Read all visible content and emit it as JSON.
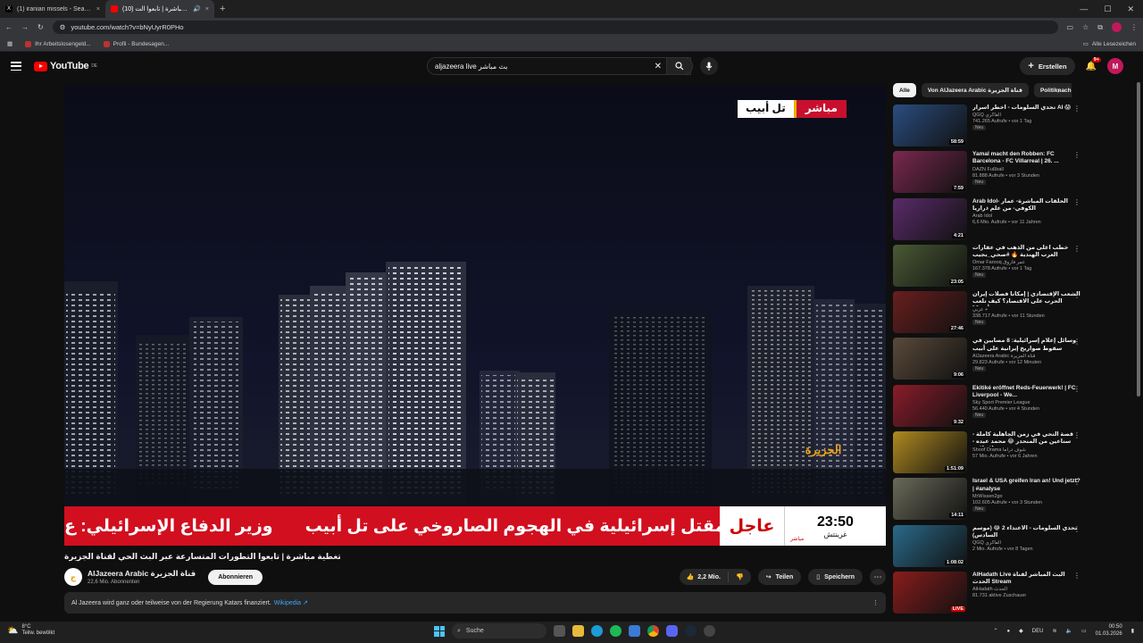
{
  "browser": {
    "tabs": [
      {
        "label": "(1) iranian missels - Search / X",
        "icon_color": "#000000",
        "close": "×"
      },
      {
        "label": "(10) تغطية مباشرة | تابعوا الت...",
        "icon_color": "#ff0000",
        "close": "×",
        "audio": "🔊"
      }
    ],
    "new_tab": "+",
    "url": "youtube.com/watch?v=bNyUyrR0PHo",
    "bookmarks": [
      "Ihr Arbeitslosengeld...",
      "Profil - Bundesagen..."
    ],
    "all_bookmarks": "Alle Lesezeichen"
  },
  "youtube": {
    "logo_text": "YouTube",
    "logo_region": "DE",
    "search_value": "aljazeera live بث مباشر",
    "create_label": "Erstellen",
    "notification_count": "9+",
    "avatar_letter": "M"
  },
  "player": {
    "live_badge": "مباشر",
    "location": "تل أبيب",
    "logo_glyph": "الجزيرة",
    "ticker_text": "ية: مقتل إسرائيلية في الهجوم الصاروخي على تل أبيب",
    "ticker_text2": "وزير الدفاع الإسرائيلي: ع",
    "urgent_label": "عاجل",
    "clock_time": "23:50",
    "clock_zone": "غرينتش",
    "clock_live": "مباشر"
  },
  "video": {
    "title": "تغطية مباشرة | تابعوا التطورات المتسارعة عبر البث الحي لقناة الجزيرة",
    "channel_name": "AlJazeera Arabic قناة الجزيرة",
    "channel_avatar": "ج",
    "subscribers": "22,6 Mio. Abonnenten",
    "subscribe_label": "Abonnieren",
    "likes": "2,2 Mio.",
    "share_label": "Teilen",
    "save_label": "Speichern",
    "notice_text": "Al Jazeera wird ganz oder teilweise von der Regierung Katars finanziert.",
    "notice_link": "Wikipedia ↗"
  },
  "chips": [
    "Alle",
    "Von AlJazeera Arabic قناة الجزيرة",
    "Politiknachrichten"
  ],
  "recommendations": [
    {
      "title": "تحدي السلومات - أخطر أسرار AI 😱",
      "channel": "QGQ الفاكري",
      "meta": "741.265 Aufrufe • vor 1 Tag",
      "duration": "58:59",
      "new": "Neu",
      "color": "#2a4d80"
    },
    {
      "title": "Yamal macht den Robben: FC Barcelona - FC Villarreal | 26. ...",
      "channel": "DAZN Fußball",
      "meta": "81.888 Aufrufe • vor 3 Stunden",
      "duration": "7:59",
      "new": "Neu",
      "color": "#7a2850"
    },
    {
      "title": "Arab Idol- الحلقات المباشرة- عمار الكوفي- من علم ذراريا",
      "channel": "Arab Idol",
      "meta": "6,6 Mio. Aufrufe • vor 11 Jahren",
      "duration": "4:21",
      "new": "",
      "color": "#5a2b6a"
    },
    {
      "title": "خطب أغلى من الذهب في عقارات العرب الهندية 🔥 #صحي_بجيب",
      "channel": "Omar Farooq عمر فاروق",
      "meta": "167.378 Aufrufe • vor 1 Tag",
      "duration": "23:05",
      "new": "Neu",
      "color": "#4a5a35"
    },
    {
      "title": "الشعب الإقتصادي | إمكانا فصلات إيران الحرب على الاقتصاد؟ كيف تلعب أمريكا ...",
      "channel": "عربي +",
      "meta": "338.717 Aufrufe • vor 11 Stunden",
      "duration": "27:46",
      "new": "Neu",
      "color": "#6a1e1e"
    },
    {
      "title": "وسائل إعلام إسرائيلية: 8 مصابين في سقوط صواريخ إيرانية على أبيب",
      "channel": "AlJazeera Arabic قناة الجزيرة",
      "meta": "29.823 Aufrufe • vor 12 Minuten",
      "duration": "9:06",
      "new": "Neu",
      "color": "#5a4a3a"
    },
    {
      "title": "Ekitiké eröffnet Reds-Feuerwerk! | FC Liverpool - We...",
      "channel": "Sky Sport Premier League",
      "meta": "56.440 Aufrufe • vor 4 Stunden",
      "duration": "9:32",
      "new": "Neu",
      "color": "#8a1c2a"
    },
    {
      "title": "قصة التحي في زمن الجاهلية كاملة - سناعين من المنحدر 😂 محمد عبده - فيلا ملاقة",
      "channel": "Shoof Drama شوف دراما",
      "meta": "57 Mio. Aufrufe • vor 6 Jahren",
      "duration": "1:51:09",
      "new": "",
      "color": "#b08a20"
    },
    {
      "title": "Israel & USA greifen Iran an! Und jetzt? | #analyse",
      "channel": "MrWissen2go",
      "meta": "102.605 Aufrufe • vor 3 Stunden",
      "duration": "14:11",
      "new": "Neu",
      "color": "#6a6a5a"
    },
    {
      "title": "تحدي السلومات - الأعتداء 2 😂 (موسم السادس)",
      "channel": "QGQ الفاكري",
      "meta": "2 Mio. Aufrufe • vor 8 Tagen",
      "duration": "1:08:02",
      "new": "",
      "color": "#2a6a8a"
    },
    {
      "title": "AlHadath Live البث المباشر لقناة الحدث Stream",
      "channel": "AlHadath الحدث",
      "meta": "81.731 aktive Zuschauer",
      "duration": "LIVE",
      "new": "",
      "color": "#8a1c1c"
    }
  ],
  "taskbar": {
    "temp": "8°C",
    "weather": "Teilw. bewölkt",
    "search": "Suche",
    "lang": "DEU",
    "time": "00:50",
    "date": "01.03.2026"
  }
}
